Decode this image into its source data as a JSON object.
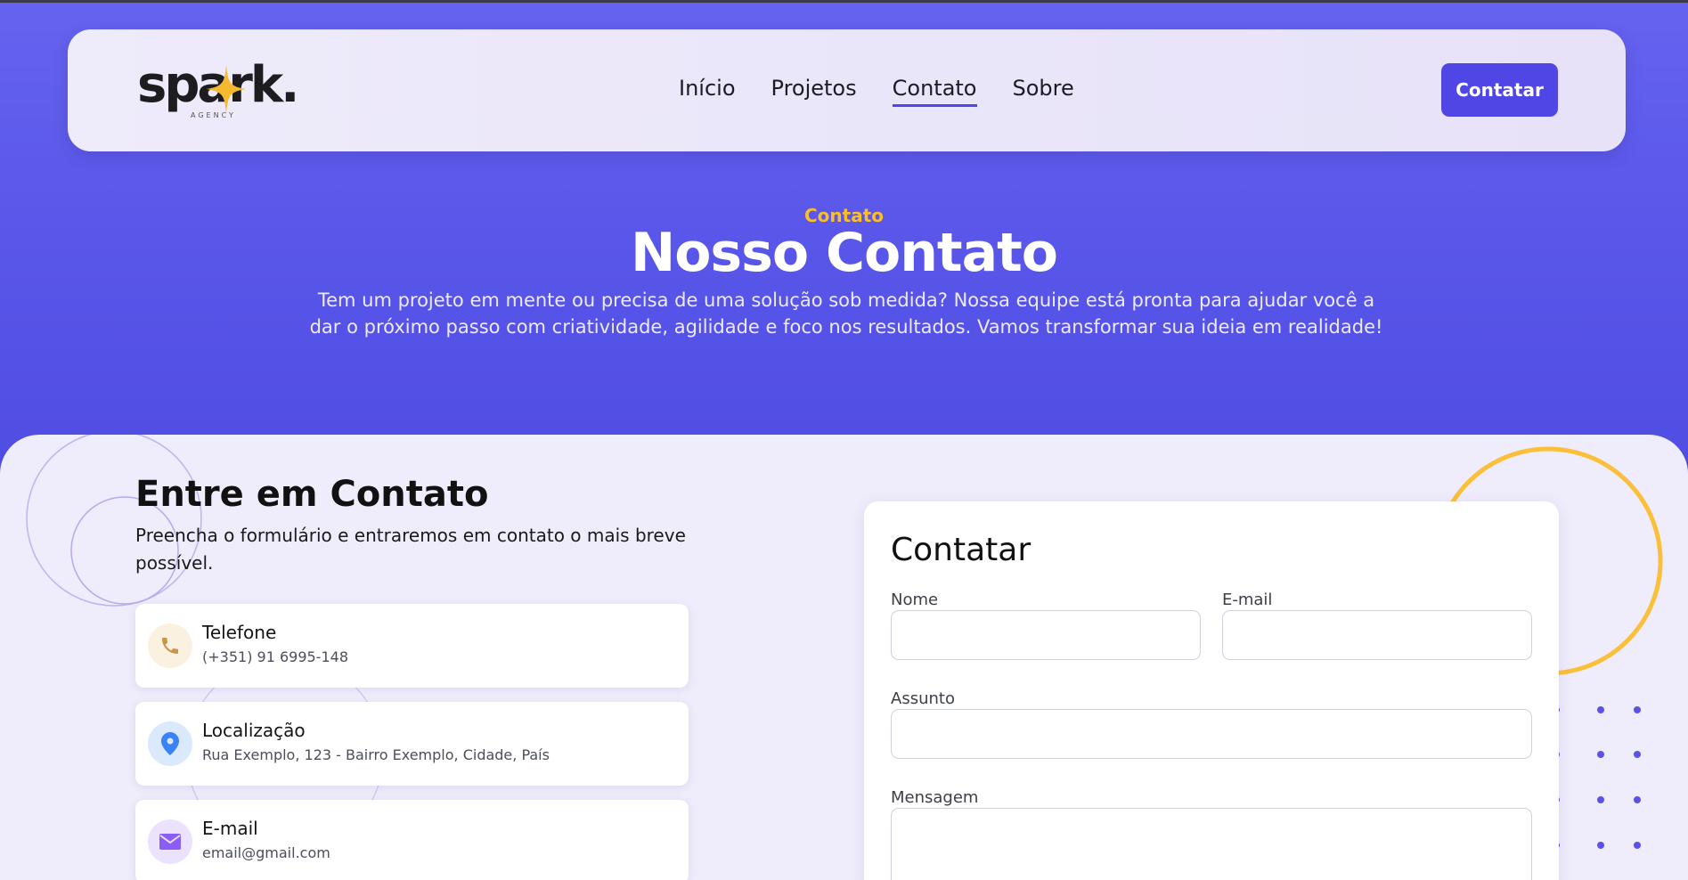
{
  "nav": {
    "logo_text": "spark.",
    "logo_sub": "AGENCY",
    "links": [
      {
        "label": "Início",
        "active": false
      },
      {
        "label": "Projetos",
        "active": false
      },
      {
        "label": "Contato",
        "active": true
      },
      {
        "label": "Sobre",
        "active": false
      }
    ],
    "cta_label": "Contatar"
  },
  "hero": {
    "eyebrow": "Contato",
    "title": "Nosso Contato",
    "description": "Tem um projeto em mente ou precisa de uma solução sob medida? Nossa equipe está pronta para ajudar você a dar o próximo passo com criatividade, agilidade e foco nos resultados. Vamos transformar sua ideia em realidade!"
  },
  "info": {
    "title": "Entre em Contato",
    "subtitle": "Preencha o formulário e entraremos em contato o mais breve possível.",
    "cards": [
      {
        "icon": "phone-icon",
        "label": "Telefone",
        "value": "(+351) 91 6995-148",
        "icon_color": "#c9944a",
        "icon_bg": "#fbf1e0"
      },
      {
        "icon": "location-pin-icon",
        "label": "Localização",
        "value": "Rua Exemplo, 123 - Bairro Exemplo, Cidade, País",
        "icon_color": "#3b82f6",
        "icon_bg": "#dbe9fd"
      },
      {
        "icon": "envelope-icon",
        "label": "E-mail",
        "value": "email@gmail.com",
        "icon_color": "#8b5cf6",
        "icon_bg": "#ebe3fd"
      }
    ]
  },
  "form": {
    "title": "Contatar",
    "name_label": "Nome",
    "name_value": "",
    "email_label": "E-mail",
    "email_value": "",
    "subject_label": "Assunto",
    "subject_value": "",
    "message_label": "Mensagem",
    "message_value": ""
  },
  "colors": {
    "accent": "#4f46e5",
    "hero_bg": "#5a57ea",
    "eyebrow": "#fbbf24",
    "content_bg": "#efecfb",
    "deco_ring": "#fbbf3a",
    "deco_dots": "#4f46e5"
  }
}
